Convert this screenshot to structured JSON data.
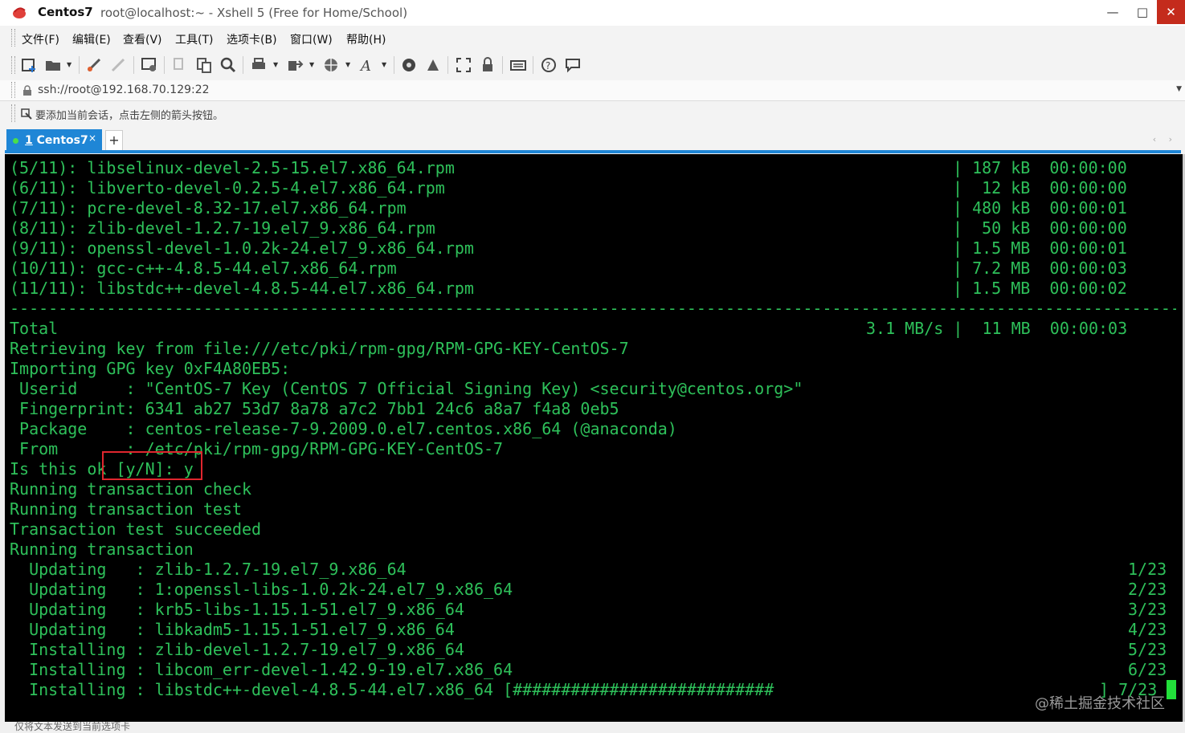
{
  "window": {
    "app_name": "Centos7",
    "subtitle": "root@localhost:~ - Xshell 5 (Free for Home/School)",
    "minimize": "—",
    "maximize": "□",
    "close": "✕"
  },
  "menu": [
    "文件(F)",
    "编辑(E)",
    "查看(V)",
    "工具(T)",
    "选项卡(B)",
    "窗口(W)",
    "帮助(H)"
  ],
  "toolbar": {
    "icons": [
      "new-session-icon",
      "open-folder-icon",
      "connect-icon",
      "disconnect-icon",
      "properties-icon",
      "copy-icon",
      "paste-icon",
      "find-icon",
      "print-icon",
      "transfer-icon",
      "globe-icon",
      "font-icon",
      "xftp-icon",
      "xmanager-icon",
      "fullscreen-icon",
      "lock-icon",
      "keyboard-icon",
      "help-icon",
      "chat-icon"
    ]
  },
  "address": {
    "value": "ssh://root@192.168.70.129:22"
  },
  "hint": {
    "text": "要添加当前会话，点击左侧的箭头按钮。"
  },
  "tabs": {
    "active_index": "1",
    "active_label": "Centos7",
    "close": "×",
    "add": "+",
    "arrows": "‹ ›"
  },
  "terminal": {
    "download_rows": [
      {
        "name": "(5/11): libselinux-devel-2.5-15.el7.x86_64.rpm",
        "stats": "| 187 kB  00:00:00"
      },
      {
        "name": "(6/11): libverto-devel-0.2.5-4.el7.x86_64.rpm",
        "stats": "|  12 kB  00:00:00"
      },
      {
        "name": "(7/11): pcre-devel-8.32-17.el7.x86_64.rpm",
        "stats": "| 480 kB  00:00:01"
      },
      {
        "name": "(8/11): zlib-devel-1.2.7-19.el7_9.x86_64.rpm",
        "stats": "|  50 kB  00:00:00"
      },
      {
        "name": "(9/11): openssl-devel-1.0.2k-24.el7_9.x86_64.rpm",
        "stats": "| 1.5 MB  00:00:01"
      },
      {
        "name": "(10/11): gcc-c++-4.8.5-44.el7.x86_64.rpm",
        "stats": "| 7.2 MB  00:00:03"
      },
      {
        "name": "(11/11): libstdc++-devel-4.8.5-44.el7.x86_64.rpm",
        "stats": "| 1.5 MB  00:00:02"
      }
    ],
    "separator": "----------------------------------------------------------------------------------------------------------------------------------------",
    "total_label": "Total",
    "total_stats": "3.1 MB/s |  11 MB  00:00:03",
    "lines": [
      "Retrieving key from file:///etc/pki/rpm-gpg/RPM-GPG-KEY-CentOS-7",
      "Importing GPG key 0xF4A80EB5:",
      " Userid     : \"CentOS-7 Key (CentOS 7 Official Signing Key) <security@centos.org>\"",
      " Fingerprint: 6341 ab27 53d7 8a78 a7c2 7bb1 24c6 a8a7 f4a8 0eb5",
      " Package    : centos-release-7-9.2009.0.el7.centos.x86_64 (@anaconda)",
      " From       : /etc/pki/rpm-gpg/RPM-GPG-KEY-CentOS-7",
      "Is this ok [y/N]: y",
      "Running transaction check",
      "Running transaction test",
      "Transaction test succeeded",
      "Running transaction"
    ],
    "transaction_rows": [
      {
        "text": "  Updating   : zlib-1.2.7-19.el7_9.x86_64",
        "count": "1/23"
      },
      {
        "text": "  Updating   : 1:openssl-libs-1.0.2k-24.el7_9.x86_64",
        "count": "2/23"
      },
      {
        "text": "  Updating   : krb5-libs-1.15.1-51.el7_9.x86_64",
        "count": "3/23"
      },
      {
        "text": "  Updating   : libkadm5-1.15.1-51.el7_9.x86_64",
        "count": "4/23"
      },
      {
        "text": "  Installing : zlib-devel-1.2.7-19.el7_9.x86_64",
        "count": "5/23"
      },
      {
        "text": "  Installing : libcom_err-devel-1.42.9-19.el7.x86_64",
        "count": "6/23"
      },
      {
        "text": "  Installing : libstdc++-devel-4.8.5-44.el7.x86_64 [###########################",
        "count": "] 7/23"
      }
    ]
  },
  "watermark": "@稀土掘金技术社区",
  "status": "仅将文本发送到当前选项卡"
}
